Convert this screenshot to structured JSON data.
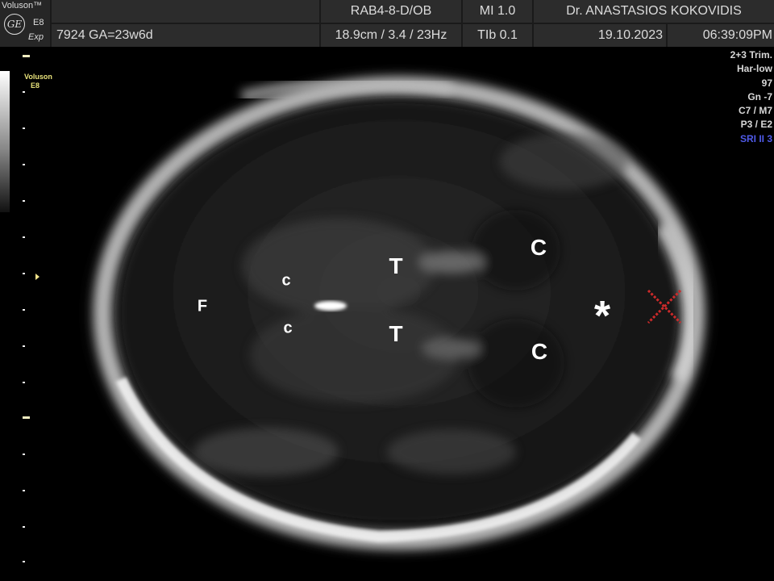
{
  "header": {
    "brand": "Voluson™",
    "model": "E8",
    "edition": "Exp",
    "logo_icon": "ge-logo",
    "probe": "RAB4-8-D/OB",
    "mi": "MI  1.0",
    "physician": "Dr. ANASTASIOS KOKOVIDIS",
    "patient": "7924  GA=23w6d",
    "depth_freq": "18.9cm / 3.4 / 23Hz",
    "tib": "TIb  0.1",
    "date": "19.10.2023",
    "time": "06:39:09PM"
  },
  "left_panel": {
    "brand": "Voluson",
    "model": "E8"
  },
  "settings": [
    "2+3 Trim.",
    "Har-low",
    "97",
    "Gn  -7",
    "C7 / M7",
    "P3 / E2",
    "SRI II 3"
  ],
  "colors": {
    "sri": "#4f5ae8",
    "header_cell": "#2c2c2c",
    "marker": "#cc2a2a"
  },
  "annotations": {
    "falx": "F",
    "c_upper_left": "c",
    "c_lower_left": "c",
    "thalamus_upper": "T",
    "thalamus_lower": "T",
    "C_upper_right": "C",
    "C_lower_right": "C",
    "asterisk": "*"
  }
}
